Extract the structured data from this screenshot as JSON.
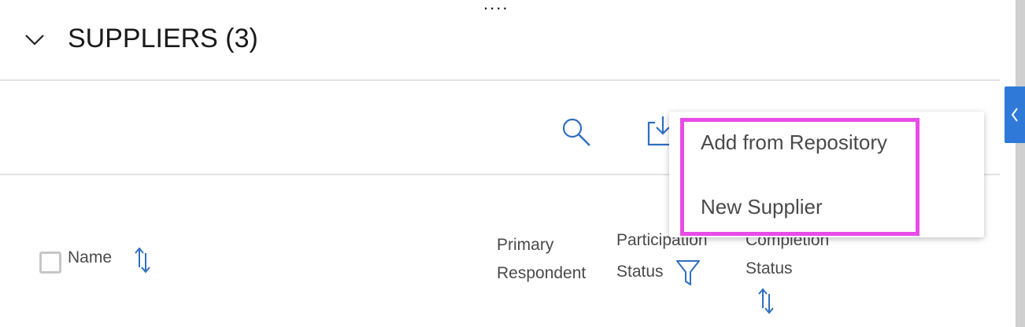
{
  "top_indicator": "....",
  "section": {
    "title": "SUPPLIERS (3)",
    "collapse_icon": "chevron-down-icon"
  },
  "toolbar": {
    "search_icon": "search-icon",
    "import_icon": "download-icon"
  },
  "dropdown_menu": {
    "items": [
      {
        "label": "Add from Repository"
      },
      {
        "label": "New Supplier"
      }
    ],
    "highlight_color": "#e84ce6"
  },
  "table": {
    "columns": {
      "name": "Name",
      "primary_respondent_line1": "Primary",
      "primary_respondent_line2": "Respondent",
      "participation_status_line1": "Participation",
      "participation_status_line2": "Status",
      "completion_status_line1": "Completion",
      "completion_status_line2": "Status"
    },
    "sort_icon": "sort-arrows-icon",
    "filter_icon": "filter-icon"
  },
  "colors": {
    "accent": "#2f7ad9",
    "icon_blue": "#2f6fbf",
    "divider": "#e2e2e2"
  }
}
